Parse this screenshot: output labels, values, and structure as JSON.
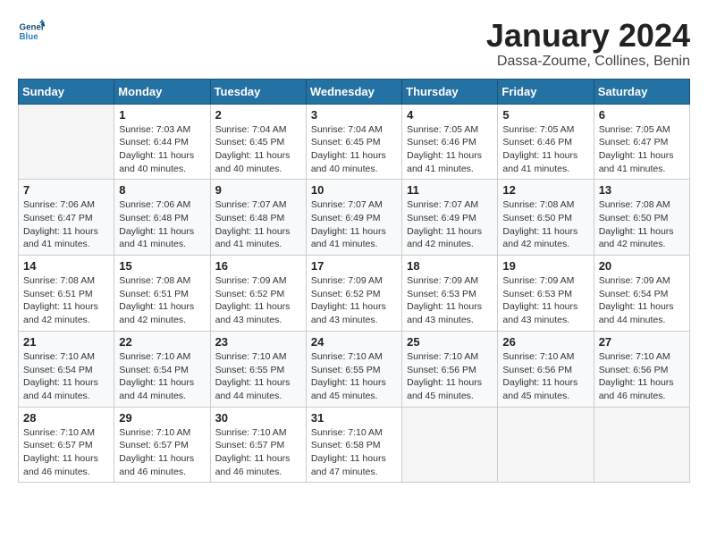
{
  "logo": {
    "line1": "General",
    "line2": "Blue"
  },
  "title": "January 2024",
  "subtitle": "Dassa-Zoume, Collines, Benin",
  "weekdays": [
    "Sunday",
    "Monday",
    "Tuesday",
    "Wednesday",
    "Thursday",
    "Friday",
    "Saturday"
  ],
  "weeks": [
    [
      {
        "day": "",
        "info": ""
      },
      {
        "day": "1",
        "info": "Sunrise: 7:03 AM\nSunset: 6:44 PM\nDaylight: 11 hours\nand 40 minutes."
      },
      {
        "day": "2",
        "info": "Sunrise: 7:04 AM\nSunset: 6:45 PM\nDaylight: 11 hours\nand 40 minutes."
      },
      {
        "day": "3",
        "info": "Sunrise: 7:04 AM\nSunset: 6:45 PM\nDaylight: 11 hours\nand 40 minutes."
      },
      {
        "day": "4",
        "info": "Sunrise: 7:05 AM\nSunset: 6:46 PM\nDaylight: 11 hours\nand 41 minutes."
      },
      {
        "day": "5",
        "info": "Sunrise: 7:05 AM\nSunset: 6:46 PM\nDaylight: 11 hours\nand 41 minutes."
      },
      {
        "day": "6",
        "info": "Sunrise: 7:05 AM\nSunset: 6:47 PM\nDaylight: 11 hours\nand 41 minutes."
      }
    ],
    [
      {
        "day": "7",
        "info": "Sunrise: 7:06 AM\nSunset: 6:47 PM\nDaylight: 11 hours\nand 41 minutes."
      },
      {
        "day": "8",
        "info": "Sunrise: 7:06 AM\nSunset: 6:48 PM\nDaylight: 11 hours\nand 41 minutes."
      },
      {
        "day": "9",
        "info": "Sunrise: 7:07 AM\nSunset: 6:48 PM\nDaylight: 11 hours\nand 41 minutes."
      },
      {
        "day": "10",
        "info": "Sunrise: 7:07 AM\nSunset: 6:49 PM\nDaylight: 11 hours\nand 41 minutes."
      },
      {
        "day": "11",
        "info": "Sunrise: 7:07 AM\nSunset: 6:49 PM\nDaylight: 11 hours\nand 42 minutes."
      },
      {
        "day": "12",
        "info": "Sunrise: 7:08 AM\nSunset: 6:50 PM\nDaylight: 11 hours\nand 42 minutes."
      },
      {
        "day": "13",
        "info": "Sunrise: 7:08 AM\nSunset: 6:50 PM\nDaylight: 11 hours\nand 42 minutes."
      }
    ],
    [
      {
        "day": "14",
        "info": "Sunrise: 7:08 AM\nSunset: 6:51 PM\nDaylight: 11 hours\nand 42 minutes."
      },
      {
        "day": "15",
        "info": "Sunrise: 7:08 AM\nSunset: 6:51 PM\nDaylight: 11 hours\nand 42 minutes."
      },
      {
        "day": "16",
        "info": "Sunrise: 7:09 AM\nSunset: 6:52 PM\nDaylight: 11 hours\nand 43 minutes."
      },
      {
        "day": "17",
        "info": "Sunrise: 7:09 AM\nSunset: 6:52 PM\nDaylight: 11 hours\nand 43 minutes."
      },
      {
        "day": "18",
        "info": "Sunrise: 7:09 AM\nSunset: 6:53 PM\nDaylight: 11 hours\nand 43 minutes."
      },
      {
        "day": "19",
        "info": "Sunrise: 7:09 AM\nSunset: 6:53 PM\nDaylight: 11 hours\nand 43 minutes."
      },
      {
        "day": "20",
        "info": "Sunrise: 7:09 AM\nSunset: 6:54 PM\nDaylight: 11 hours\nand 44 minutes."
      }
    ],
    [
      {
        "day": "21",
        "info": "Sunrise: 7:10 AM\nSunset: 6:54 PM\nDaylight: 11 hours\nand 44 minutes."
      },
      {
        "day": "22",
        "info": "Sunrise: 7:10 AM\nSunset: 6:54 PM\nDaylight: 11 hours\nand 44 minutes."
      },
      {
        "day": "23",
        "info": "Sunrise: 7:10 AM\nSunset: 6:55 PM\nDaylight: 11 hours\nand 44 minutes."
      },
      {
        "day": "24",
        "info": "Sunrise: 7:10 AM\nSunset: 6:55 PM\nDaylight: 11 hours\nand 45 minutes."
      },
      {
        "day": "25",
        "info": "Sunrise: 7:10 AM\nSunset: 6:56 PM\nDaylight: 11 hours\nand 45 minutes."
      },
      {
        "day": "26",
        "info": "Sunrise: 7:10 AM\nSunset: 6:56 PM\nDaylight: 11 hours\nand 45 minutes."
      },
      {
        "day": "27",
        "info": "Sunrise: 7:10 AM\nSunset: 6:56 PM\nDaylight: 11 hours\nand 46 minutes."
      }
    ],
    [
      {
        "day": "28",
        "info": "Sunrise: 7:10 AM\nSunset: 6:57 PM\nDaylight: 11 hours\nand 46 minutes."
      },
      {
        "day": "29",
        "info": "Sunrise: 7:10 AM\nSunset: 6:57 PM\nDaylight: 11 hours\nand 46 minutes."
      },
      {
        "day": "30",
        "info": "Sunrise: 7:10 AM\nSunset: 6:57 PM\nDaylight: 11 hours\nand 46 minutes."
      },
      {
        "day": "31",
        "info": "Sunrise: 7:10 AM\nSunset: 6:58 PM\nDaylight: 11 hours\nand 47 minutes."
      },
      {
        "day": "",
        "info": ""
      },
      {
        "day": "",
        "info": ""
      },
      {
        "day": "",
        "info": ""
      }
    ]
  ]
}
